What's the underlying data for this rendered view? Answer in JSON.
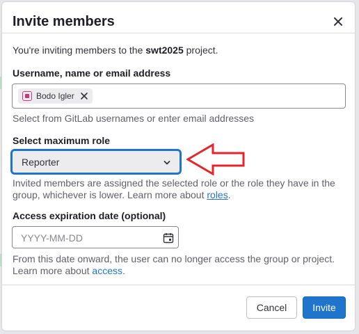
{
  "modal": {
    "title": "Invite members",
    "intro_prefix": "You're inviting members to the ",
    "project_name": "swt2025",
    "intro_suffix": " project."
  },
  "user_field": {
    "label": "Username, name or email address",
    "token_name": "Bodo Igler",
    "help": "Select from GitLab usernames or enter email addresses"
  },
  "role_field": {
    "label": "Select maximum role",
    "selected": "Reporter",
    "help_text": "Invited members are assigned the selected role or the role they have in the group, whichever is lower. Learn more about ",
    "help_link": "roles",
    "help_end": "."
  },
  "expiration_field": {
    "label": "Access expiration date (optional)",
    "placeholder": "YYYY-MM-DD",
    "help_text": "From this date onward, the user can no longer access the group or project. Learn more about ",
    "help_link": "access",
    "help_end": "."
  },
  "footer": {
    "cancel_label": "Cancel",
    "invite_label": "Invite"
  },
  "colors": {
    "accent": "#1f75cb",
    "annotation_arrow": "#e3262b"
  },
  "icons": [
    "close-icon",
    "remove-token-icon",
    "chevron-down-icon",
    "calendar-icon",
    "avatar-icon"
  ]
}
